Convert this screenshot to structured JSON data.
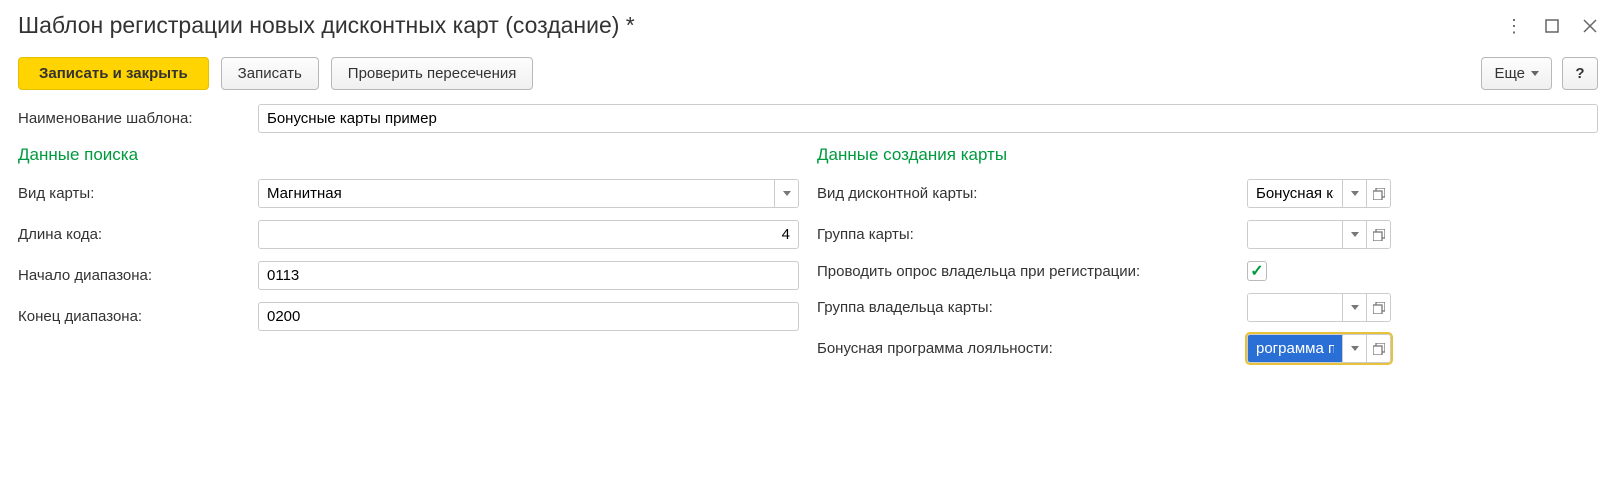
{
  "titlebar": {
    "title": "Шаблон регистрации новых дисконтных карт (создание) *"
  },
  "toolbar": {
    "save_close": "Записать и закрыть",
    "save": "Записать",
    "check": "Проверить пересечения",
    "more": "Еще",
    "help": "?"
  },
  "labels": {
    "template_name": "Наименование шаблона:",
    "search_section": "Данные поиска",
    "card_type": "Вид карты:",
    "code_length": "Длина кода:",
    "range_start": "Начало диапазона:",
    "range_end": "Конец диапазона:",
    "create_section": "Данные создания карты",
    "discount_type": "Вид дисконтной карты:",
    "card_group": "Группа карты:",
    "survey": "Проводить опрос владельца при регистрации:",
    "owner_group": "Группа владельца карты:",
    "loyalty": "Бонусная программа лояльности:"
  },
  "values": {
    "template_name": "Бонусные карты пример",
    "card_type": "Магнитная",
    "code_length": "4",
    "range_start": "0113",
    "range_end": "0200",
    "discount_type": "Бонусная карта пр",
    "card_group": "",
    "owner_group": "",
    "loyalty": "рограмма пример",
    "survey_checked": true
  }
}
